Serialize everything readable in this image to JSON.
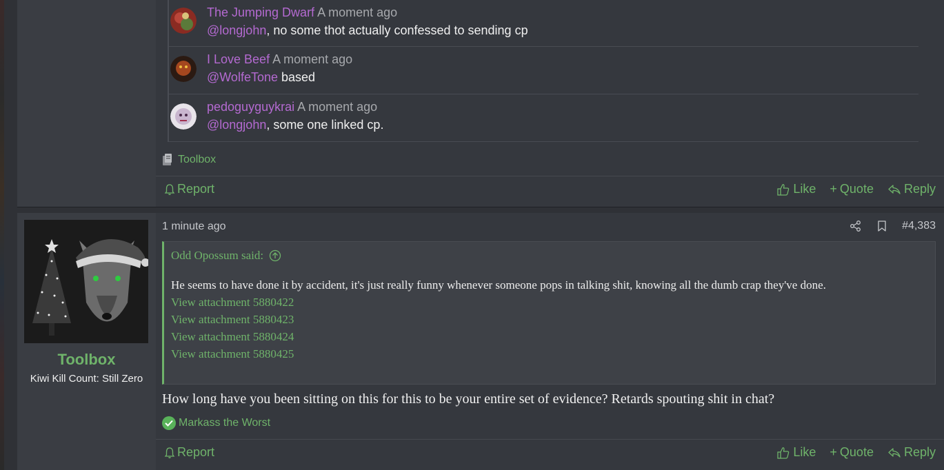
{
  "comments": [
    {
      "user": "The Jumping Dwarf",
      "time": "A moment ago",
      "mention": "@longjohn",
      "text": ", no some thot actually confessed to sending cp"
    },
    {
      "user": "I Love Beef",
      "time": "A moment ago",
      "mention": "@WolfeTone",
      "text": " based"
    },
    {
      "user": "pedoguyguykrai",
      "time": "A moment ago",
      "mention": "@longjohn",
      "text": ", some one linked cp."
    }
  ],
  "post1": {
    "reaction_user": "Toolbox",
    "actions": {
      "report": "Report",
      "like": "Like",
      "quote": "Quote",
      "reply": "Reply"
    }
  },
  "post2": {
    "poster_name": "Toolbox",
    "poster_title": "Kiwi Kill Count: Still Zero",
    "date": "1 minute ago",
    "post_number": "#4,383",
    "quote": {
      "author": "Odd Opossum said:",
      "text": "He seems to have done it by accident, it's just really funny whenever someone pops in talking shit, knowing all the dumb crap they've done.",
      "attachments": [
        "View attachment 5880422",
        "View attachment 5880423",
        "View attachment 5880424",
        "View attachment 5880425"
      ]
    },
    "body": "How long have you been sitting on this for this to be your entire set of evidence? Retards spouting shit in chat?",
    "reaction_user": "Markass the Worst",
    "actions": {
      "report": "Report",
      "like": "Like",
      "quote": "Quote",
      "reply": "Reply"
    }
  },
  "colors": {
    "accent": "#6fb36a",
    "username": "#b46ad1",
    "background": "#2f3136"
  }
}
